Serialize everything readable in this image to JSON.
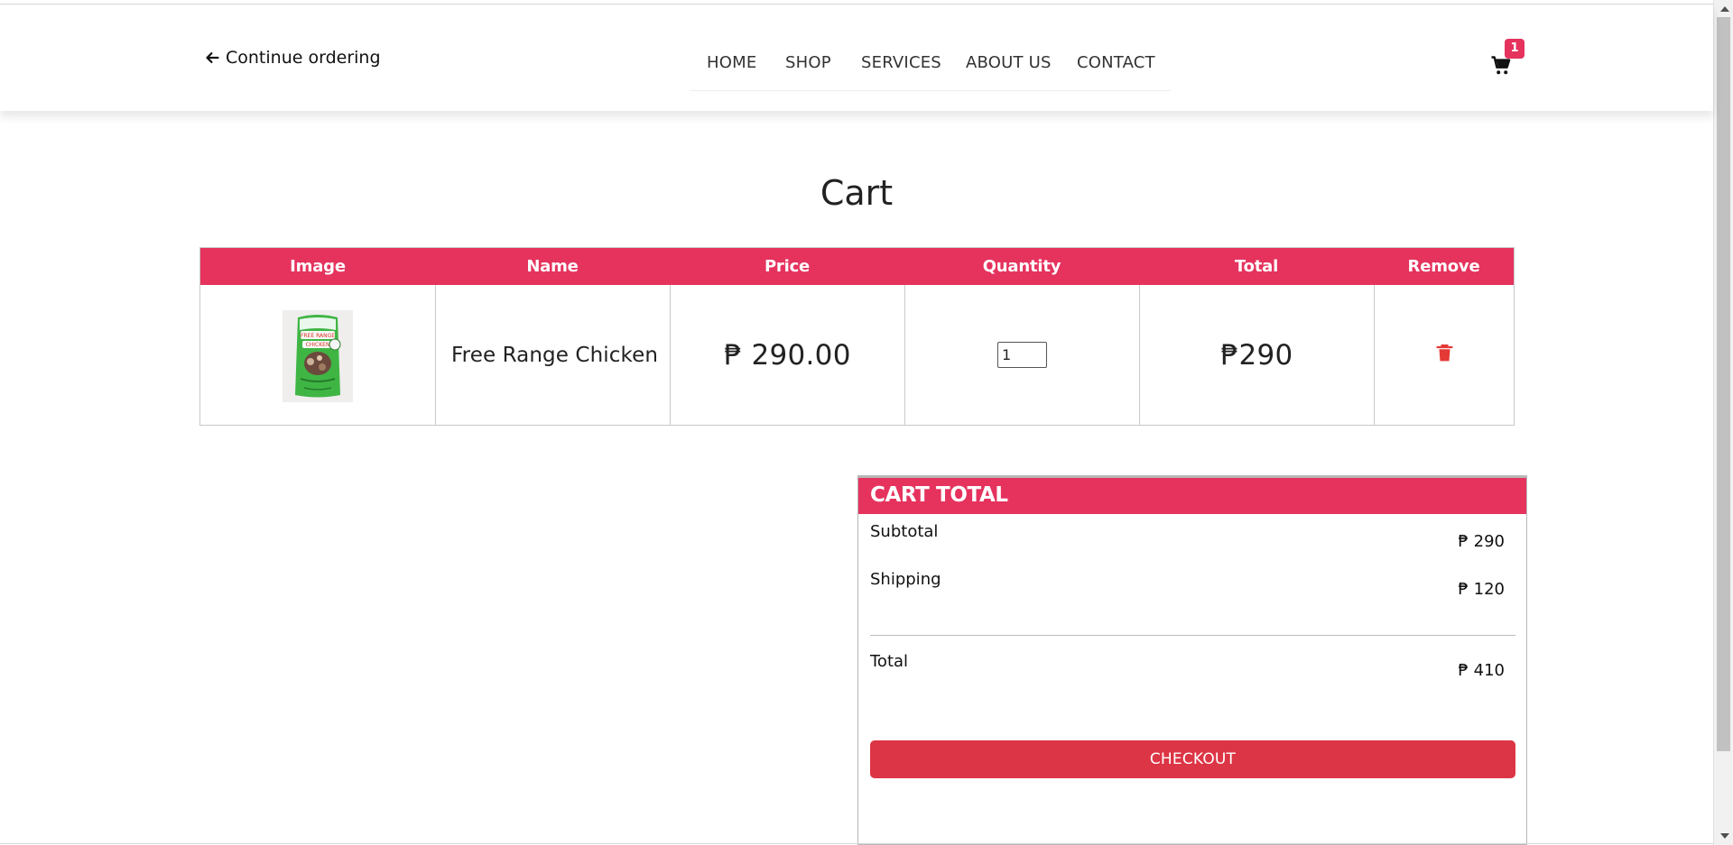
{
  "header": {
    "continue_label": "Continue ordering",
    "nav": [
      "HOME",
      "SHOP",
      "SERVICES",
      "ABOUT US",
      "CONTACT"
    ],
    "cart_count": "1",
    "icons": {
      "back": "arrow-left-icon",
      "cart": "cart-icon"
    }
  },
  "page": {
    "title": "Cart"
  },
  "cart_table": {
    "headers": [
      "Image",
      "Name",
      "Price",
      "Quantity",
      "Total",
      "Remove"
    ],
    "rows": [
      {
        "name": "Free Range Chicken",
        "price": "₱ 290.00",
        "quantity": "1",
        "total": "₱290"
      }
    ],
    "remove_icon": "trash-icon"
  },
  "summary": {
    "title": "CART TOTAL",
    "subtotal_label": "Subtotal",
    "subtotal_value": "₱ 290",
    "shipping_label": "Shipping",
    "shipping_value": "₱ 120",
    "total_label": "Total",
    "total_value": "₱ 410",
    "checkout_label": "CHECKOUT"
  },
  "colors": {
    "accent": "#e5335e",
    "checkout": "#dc3545",
    "trash": "#e53935"
  }
}
